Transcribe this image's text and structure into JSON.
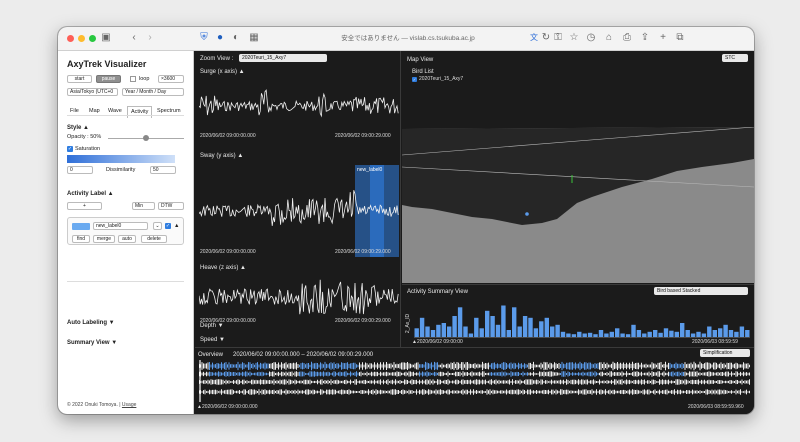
{
  "browser": {
    "url_text": "安全ではありません — vislab.cs.tsukuba.ac.jp"
  },
  "sidebar": {
    "title": "AxyTrek Visualizer",
    "start_label": "start",
    "pause_label": "pause",
    "loop_label": "loop",
    "speed_value": "×3600",
    "timezone_value": "Asia/Tokyo (UTC+0",
    "date_format_value": "Year / Month / Day",
    "tabs": [
      "File",
      "Map",
      "Wave",
      "Activity",
      "Spectrum"
    ],
    "active_tab": "Activity",
    "style_label": "Style ▲",
    "opacity_label": "Opacity : 50%",
    "opacity": 0.5,
    "saturation_label": "Saturation",
    "sat_min": "0",
    "dissimilarity_label": "Dissimilarity",
    "sat_max": "50",
    "activity_label_header": "Activity Label ▲",
    "plus_label": "+",
    "min_value": "Min",
    "dtw_value": "DTW",
    "label_name": "new_label0",
    "label_caret": "▲",
    "find_label": "find",
    "merge_label": "merge",
    "auto_label": "auto",
    "delete_label": "delete",
    "auto_labeling": "Auto Labeling ▼",
    "summary_view": "Summary View ▼",
    "footer_text": "© 2022 Onuki Tomoya. | ",
    "footer_link": "Usage"
  },
  "zoom": {
    "label": "Zoom View :",
    "select_value": "2020Teuri_15_Axy7",
    "surge": "Surge (x axis) ▲",
    "sway": "Sway (y axis) ▲",
    "heave": "Heave (z axis) ▲",
    "depth": "Depth ▼",
    "speed": "Speed ▼",
    "t_start": "2020/06/02 09:00:00.000",
    "t_end": "2020/06/02 09:00:29.000",
    "highlight_label": "new_label0"
  },
  "map": {
    "title": "Map View",
    "stc_value": "STC",
    "bird_list": "Bird List",
    "bird": "2020Teuri_15_Axy7"
  },
  "summary": {
    "title": "Activity Summary View",
    "mode_value": "Bird based Stacked",
    "y_axis_label": "2_Ax_ID",
    "t_start": "▲2020/06/02 09:00:00",
    "t_end": "2020/06/03 08:59:59",
    "bars": [
      0.25,
      0.55,
      0.3,
      0.2,
      0.35,
      0.4,
      0.3,
      0.6,
      0.85,
      0.3,
      0.1,
      0.55,
      0.25,
      0.75,
      0.6,
      0.35,
      0.9,
      0.2,
      0.85,
      0.3,
      0.6,
      0.55,
      0.25,
      0.45,
      0.55,
      0.3,
      0.35,
      0.15,
      0.1,
      0.08,
      0.15,
      0.1,
      0.12,
      0.08,
      0.2,
      0.1,
      0.15,
      0.25,
      0.1,
      0.08,
      0.35,
      0.2,
      0.1,
      0.15,
      0.2,
      0.12,
      0.25,
      0.18,
      0.15,
      0.4,
      0.2,
      0.1,
      0.15,
      0.1,
      0.3,
      0.2,
      0.25,
      0.35,
      0.2,
      0.15,
      0.3,
      0.2
    ]
  },
  "overview": {
    "title": "Overview",
    "range": "2020/06/02 09:00:00.000 – 2020/06/02 09:00:29.000",
    "simplification_value": "Simplification",
    "t_start": "▲2020/06/02 09:00:00.000",
    "t_end": "2020/06/03 08:59:59.960"
  },
  "colors": {
    "accent": "#5b9bea",
    "highlight": "#2f7de0",
    "panel_bg": "#1b1b1b"
  }
}
